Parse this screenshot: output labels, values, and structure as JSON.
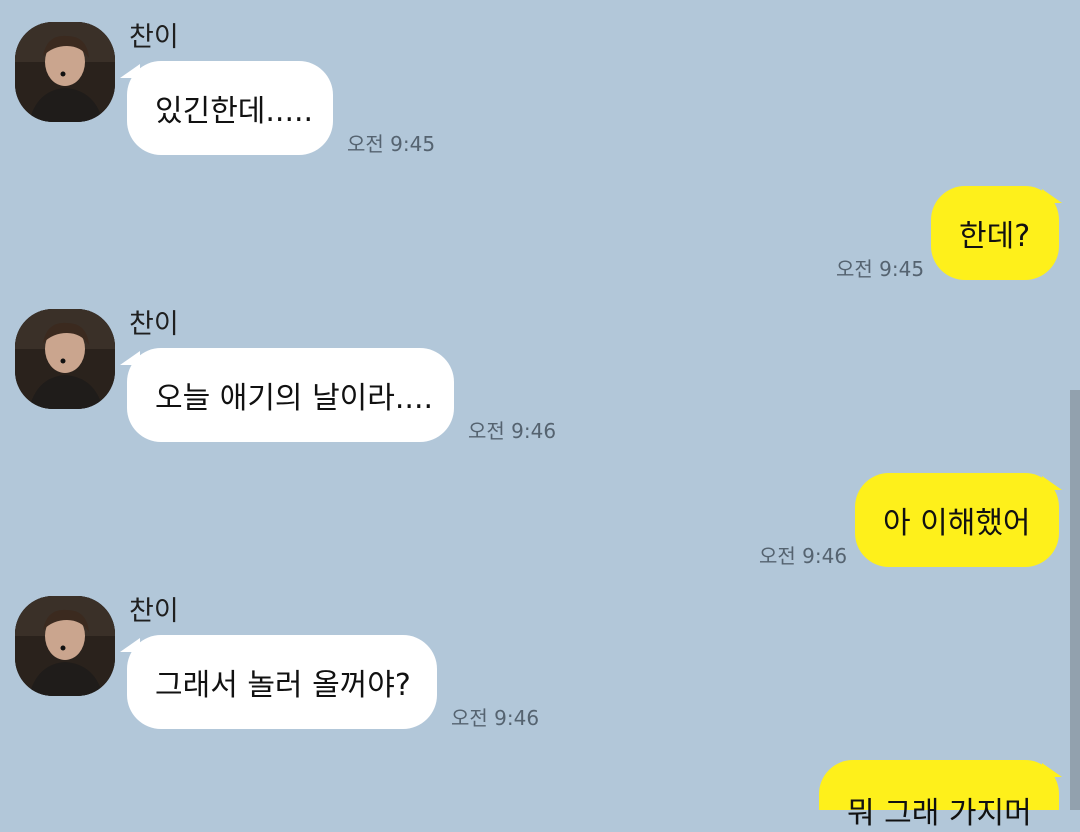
{
  "messages": [
    {
      "type": "received",
      "sender": "찬이",
      "text": "있긴한데.....",
      "time": "오전 9:45",
      "avatar": "profile-avatar"
    },
    {
      "type": "sent",
      "text": "한데?",
      "time": "오전 9:45"
    },
    {
      "type": "received",
      "sender": "찬이",
      "text": "오늘 애기의 날이라....",
      "time": "오전 9:46",
      "avatar": "profile-avatar"
    },
    {
      "type": "sent",
      "text": "아 이해했어",
      "time": "오전 9:46"
    },
    {
      "type": "received",
      "sender": "찬이",
      "text": "그래서 놀러 올꺼야?",
      "time": "오전 9:46",
      "avatar": "profile-avatar"
    },
    {
      "type": "sent",
      "text": "뭐 그래 가지머",
      "time": ""
    }
  ],
  "colors": {
    "background": "#b2c7d9",
    "received_bubble": "#ffffff",
    "sent_bubble": "#fef01b",
    "timestamp": "#556370"
  }
}
